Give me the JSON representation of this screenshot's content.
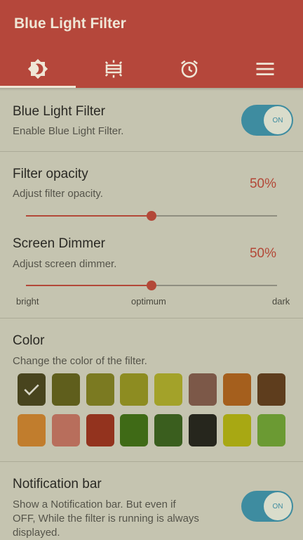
{
  "app": {
    "title": "Blue Light Filter"
  },
  "tabs": [
    {
      "icon": "brightness-icon",
      "active": true
    },
    {
      "icon": "screen-brightness-icon"
    },
    {
      "icon": "alarm-icon"
    },
    {
      "icon": "menu-icon"
    }
  ],
  "filter": {
    "title": "Blue Light Filter",
    "subtitle": "Enable Blue Light Filter.",
    "switch_label": "ON",
    "on": true
  },
  "opacity": {
    "title": "Filter opacity",
    "subtitle": "Adjust filter opacity.",
    "value_text": "50%",
    "value": 0.5
  },
  "dimmer": {
    "title": "Screen Dimmer",
    "subtitle": "Adjust screen dimmer.",
    "value_text": "50%",
    "value": 0.5,
    "ticks": {
      "left": "bright",
      "center": "optimum",
      "right": "dark"
    }
  },
  "color": {
    "title": "Color",
    "subtitle": "Change the color of the filter.",
    "swatches_row1": [
      "#48441e",
      "#5f5e1c",
      "#7b7a21",
      "#8d8c21",
      "#a3a229",
      "#7c5848",
      "#a55f1d",
      "#5e3d1d"
    ],
    "swatches_row2": [
      "#c17d2d",
      "#b86e5c",
      "#93331e",
      "#3f6a16",
      "#3a5e1e",
      "#26261d",
      "#a8a813",
      "#6b9a33"
    ],
    "selected_index": 0
  },
  "notification": {
    "title": "Notification bar",
    "subtitle_line1": "Show a Notification bar. But even if",
    "subtitle_line2": "OFF, While the filter is running is always",
    "subtitle_line3": "displayed.",
    "switch_label": "ON",
    "on": true
  }
}
